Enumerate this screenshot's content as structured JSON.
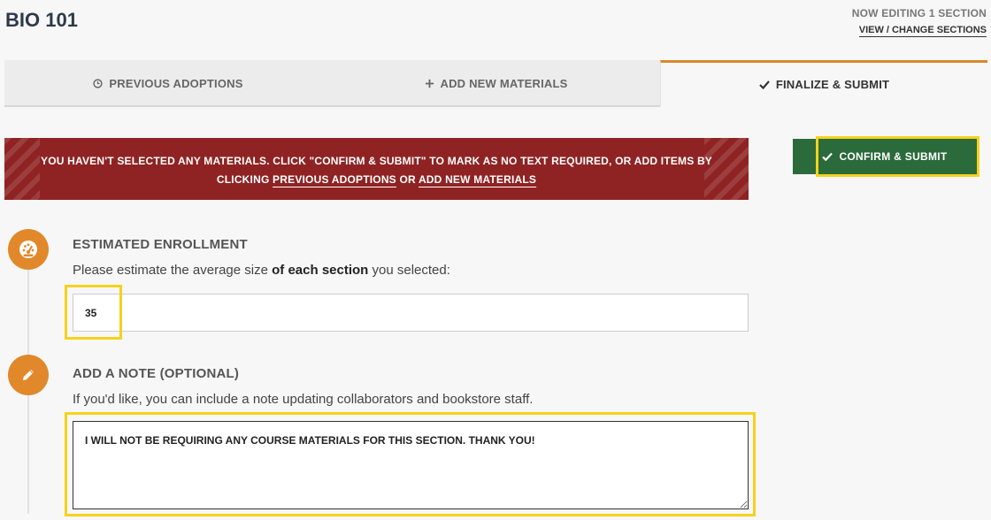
{
  "header": {
    "course_title": "BIO 101",
    "editing_status": "NOW EDITING 1 SECTION",
    "change_sections_link": "VIEW / CHANGE SECTIONS"
  },
  "tabs": [
    {
      "label": "PREVIOUS ADOPTIONS",
      "icon": "clock-icon",
      "active": false
    },
    {
      "label": "ADD NEW MATERIALS",
      "icon": "plus-icon",
      "active": false
    },
    {
      "label": "FINALIZE & SUBMIT",
      "icon": "check-icon",
      "active": true
    }
  ],
  "banner": {
    "text_before": "YOU HAVEN'T SELECTED ANY MATERIALS. CLICK \"CONFIRM & SUBMIT\" TO MARK AS NO TEXT REQUIRED, OR ADD ITEMS BY CLICKING",
    "link1": "PREVIOUS ADOPTIONS",
    "connector": "OR",
    "link2": "ADD NEW MATERIALS",
    "color": "#8f2323"
  },
  "confirm_button": {
    "label": "CONFIRM & SUBMIT",
    "color": "#2b6a3a"
  },
  "enrollment": {
    "title": "ESTIMATED ENROLLMENT",
    "desc_before": "Please estimate the average size",
    "desc_bold": "of each section",
    "desc_after": "you selected:",
    "value": "35",
    "icon": "gauge-icon"
  },
  "note": {
    "title": "ADD A NOTE (OPTIONAL)",
    "desc": "If you'd like, you can include a note updating collaborators and bookstore staff.",
    "value": "I WILL NOT BE REQUIRING ANY COURSE MATERIALS FOR THIS SECTION. THANK YOU!",
    "icon": "pencil-icon"
  },
  "colors": {
    "accent": "#e0882a",
    "highlight": "#f5d21c",
    "title": "#2d3a4a"
  }
}
